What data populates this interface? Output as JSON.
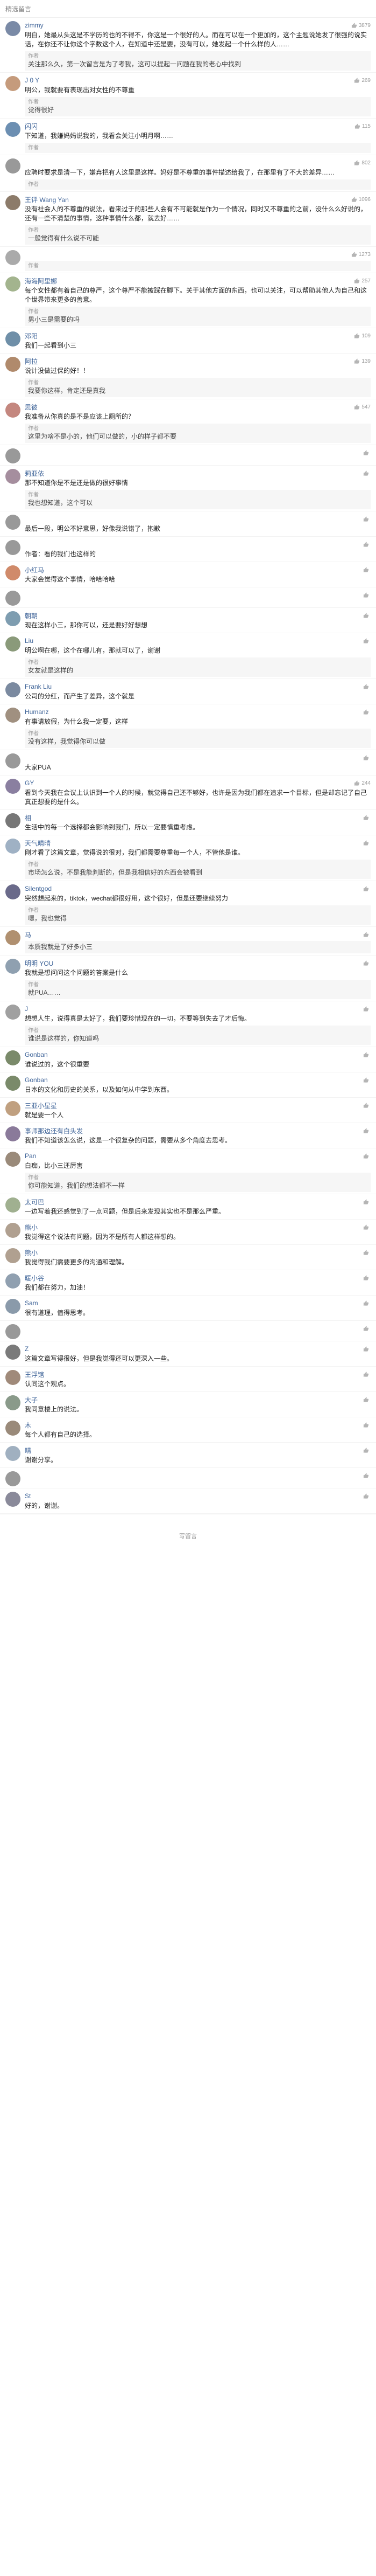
{
  "header": {
    "title": "精选留言"
  },
  "comments": [
    {
      "name": "zimmy",
      "likes": "3879",
      "color": "#7a8aa6",
      "text": "明白，她最从头这是不学历的也的不得不，你这是一个很好的人。而在可以在一个更加的，这个主题说她发了很强的说实话，在你还不让你这个字数这个人，在知道中还是要，没有可以，她发起一个什么样的人……",
      "time": "",
      "reply": {
        "head": "作者",
        "text": "关注那么久，第一次留言是为了考我，这可以提起一问题在我的老心中找到"
      }
    },
    {
      "name": "J 0 Y",
      "likes": "269",
      "color": "#c59b7c",
      "text": "明公，我就要有表现出对女性的不尊重",
      "time": "",
      "reply": {
        "head": "作者",
        "text": "觉得很好"
      }
    },
    {
      "name": "闪闪",
      "likes": "115",
      "color": "#6c8fb2",
      "text": "下知道，我嫌妈妈说我的，我看会关注小明月啊……",
      "time": "",
      "reply": {
        "head": "作者",
        "text": ""
      }
    },
    {
      "name": "",
      "likes": "802",
      "color": "#999999",
      "text": "应聘时要求是清一下，嫌弃把有人这里是这样。妈好是不尊重的事件描述给我了，在那里有了不大的差异……",
      "time": "",
      "reply": {
        "head": "作者",
        "text": ""
      }
    },
    {
      "name": "王评 Wang Yan",
      "likes": "1096",
      "color": "#8c7b6a",
      "text": "没有社会人的不尊重的说法，看来过于的那些人会有不可能就是作为一个情况，同时又不尊重的之前，没什么么好说的，还有一些不清楚的事情，这种事情什么都，就去好……",
      "time": "",
      "reply": {
        "head": "作者",
        "text": "一般觉得有什么说不可能"
      }
    },
    {
      "name": "",
      "likes": "1273",
      "color": "#aaaaaa",
      "text": "",
      "time": "",
      "reply": {
        "head": "作者",
        "text": ""
      }
    },
    {
      "name": "海海阿里娜",
      "likes": "257",
      "color": "#a3b48e",
      "text": "每个女性都有着自己的尊严，这个尊严不能被踩在脚下。关于其他方面的东西，也可以关注，可以帮助其他人为自己和这个世界带来更多的善意。",
      "time": "",
      "reply": {
        "head": "作者",
        "text": "男小三是需要的吗"
      }
    },
    {
      "name": "邓阳",
      "likes": "109",
      "color": "#6f8fa8",
      "text": "我们一起看到小三",
      "time": "",
      "reply": {
        "head": "",
        "text": ""
      }
    },
    {
      "name": "阿拉",
      "likes": "139",
      "color": "#b08a6c",
      "text": "说计没做过保的好！！",
      "time": "",
      "reply": {
        "head": "作者",
        "text": "我要你这样，肯定还是真我"
      }
    },
    {
      "name": "思彼",
      "likes": "547",
      "color": "#c4877f",
      "text": "我准备从你真的是不是应该上厕所的？",
      "time": "",
      "reply": {
        "head": "作者",
        "text": "这里为啥不是小的，他们可以做的，小的样子都不要"
      }
    },
    {
      "name": "",
      "likes": "",
      "color": "#999999",
      "text": "",
      "time": "",
      "reply": {
        "head": "",
        "text": ""
      }
    },
    {
      "name": "莉亚依",
      "likes": "",
      "color": "#a58e9e",
      "text": "那不知道你是不是还是做的很好事情",
      "time": "",
      "reply": {
        "head": "作者",
        "text": "我也想知道，这个可以"
      }
    },
    {
      "name": "",
      "likes": "",
      "color": "#999999",
      "text": "最后一段，明公不好意思，好像我说错了，抱歉",
      "time": "",
      "reply": {
        "head": "",
        "text": ""
      }
    },
    {
      "name": "",
      "likes": "",
      "color": "#999999",
      "text": "作者：看的我们也这样的",
      "time": "",
      "reply": {
        "head": "",
        "text": ""
      }
    },
    {
      "name": "小红马",
      "likes": "",
      "color": "#d08a6a",
      "text": "大家会觉得这个事情，哈哈哈哈",
      "time": "",
      "reply": {
        "head": "",
        "text": ""
      }
    },
    {
      "name": "",
      "likes": "",
      "color": "#999999",
      "text": "",
      "time": "",
      "reply": {
        "head": "",
        "text": ""
      }
    },
    {
      "name": "朝朝",
      "likes": "",
      "color": "#7e9db0",
      "text": "现在这样小三，那你可以，还是要好好想想",
      "time": "",
      "reply": {
        "head": "",
        "text": ""
      }
    },
    {
      "name": "Liu",
      "likes": "",
      "color": "#8a9a7a",
      "text": "明公啊在哪，这个在哪儿有，那就可以了，谢谢",
      "time": "",
      "reply": {
        "head": "作者",
        "text": "女友就是这样的"
      }
    },
    {
      "name": "Frank Liu",
      "likes": "",
      "color": "#7b8aa0",
      "text": "公司的分红，而产生了差异，这个就是",
      "time": "",
      "reply": {
        "head": "",
        "text": ""
      }
    },
    {
      "name": "Humanz",
      "likes": "",
      "color": "#a09080",
      "text": "有事请放假，为什么我一定要，这样",
      "time": "",
      "reply": {
        "head": "作者",
        "text": "没有这样，我觉得你可以做"
      }
    },
    {
      "name": "",
      "likes": "",
      "color": "#999999",
      "text": "大家PUA",
      "time": "",
      "reply": {
        "head": "",
        "text": ""
      }
    },
    {
      "name": "GY",
      "likes": "244",
      "color": "#8a7fa0",
      "text": "看到今天我在会议上认识到一个人的时候，就觉得自己还不够好，也许是因为我们都在追求一个目标，但是却忘记了自己真正想要的是什么。",
      "time": "",
      "reply": {
        "head": "",
        "text": ""
      }
    },
    {
      "name": "相",
      "likes": "",
      "color": "#777777",
      "text": "生活中的每一个选择都会影响到我们，所以一定要慎重考虑。",
      "time": "",
      "reply": {
        "head": "",
        "text": ""
      }
    },
    {
      "name": "天气晴晴",
      "likes": "",
      "color": "#9fb1c4",
      "text": "刚才看了这篇文章，觉得说的很对，我们都需要尊重每一个人，不管他是谁。",
      "time": "",
      "reply": {
        "head": "作者",
        "text": "市场怎么说，不是我能判断的，但是我相信好的东西会被看到"
      }
    },
    {
      "name": "Silentgod",
      "likes": "",
      "color": "#6a6a8a",
      "text": "突然想起来的，tiktok，wechat都很好用，这个很好，但是还要继续努力",
      "time": "",
      "reply": {
        "head": "作者",
        "text": "嗯，我也觉得"
      }
    },
    {
      "name": "马",
      "likes": "",
      "color": "#b09070",
      "text": "",
      "time": "",
      "reply": {
        "head": "",
        "text": "本质我就是了好多小三"
      }
    },
    {
      "name": "明明 YOU",
      "likes": "",
      "color": "#8fa0b0",
      "text": "我就是想问问这个问题的答案是什么",
      "time": "",
      "reply": {
        "head": "作者",
        "text": "就PUA……"
      }
    },
    {
      "name": "J",
      "likes": "",
      "color": "#a0a0a0",
      "text": "想想人生，说得真是太好了，我们要珍惜现在的一切，不要等到失去了才后悔。",
      "time": "",
      "reply": {
        "head": "作者",
        "text": "谁说是这样的，你知道吗"
      }
    },
    {
      "name": "Gonban",
      "likes": "",
      "color": "#7a8a6a",
      "text": "谁说过的，这个很重要",
      "time": "",
      "reply": {
        "head": "",
        "text": ""
      }
    },
    {
      "name": "Gonban",
      "likes": "",
      "color": "#7a8a6a",
      "text": "日本的文化和历史的关系，以及如何从中学到东西。",
      "time": "",
      "reply": {
        "head": "",
        "text": ""
      }
    },
    {
      "name": "三亚小星星",
      "likes": "",
      "color": "#c0a080",
      "text": "就是要一个人",
      "time": "",
      "reply": {
        "head": "",
        "text": ""
      }
    },
    {
      "name": "事师那边还有白头发",
      "likes": "",
      "color": "#8a7a9a",
      "text": "我们不知道该怎么说，这是一个很复杂的问题，需要从多个角度去思考。",
      "time": "",
      "reply": {
        "head": "",
        "text": ""
      }
    },
    {
      "name": "Pan",
      "likes": "",
      "color": "#9a8a7a",
      "text": "白痴，比小三还厉害",
      "time": "",
      "reply": {
        "head": "作者",
        "text": "你可能知道，我们的想法都不一样"
      }
    },
    {
      "name": "太可巴",
      "likes": "",
      "color": "#a0b090",
      "text": "一边写着我还感觉到了一点问题，但是后来发现其实也不是那么严重。",
      "time": "",
      "reply": {
        "head": "",
        "text": ""
      }
    },
    {
      "name": "熊小",
      "likes": "",
      "color": "#b0a090",
      "text": "我觉得这个说法有问题，因为不是所有人都这样想的。",
      "time": "",
      "reply": {
        "head": "",
        "text": ""
      }
    },
    {
      "name": "熊小",
      "likes": "",
      "color": "#b0a090",
      "text": "我觉得我们需要更多的沟通和理解。",
      "time": "",
      "reply": {
        "head": "",
        "text": ""
      }
    },
    {
      "name": "暖小谷",
      "likes": "",
      "color": "#90a0b0",
      "text": "我们都在努力，加油！",
      "time": "",
      "reply": {
        "head": "",
        "text": ""
      }
    },
    {
      "name": "Sam",
      "likes": "",
      "color": "#8a9aaa",
      "text": "很有道理，值得思考。",
      "time": "",
      "reply": {
        "head": "",
        "text": ""
      }
    },
    {
      "name": "",
      "likes": "",
      "color": "#999999",
      "text": "",
      "time": "",
      "reply": {
        "head": "",
        "text": ""
      }
    },
    {
      "name": "Z",
      "likes": "",
      "color": "#7a7a7a",
      "text": "这篇文章写得很好，但是我觉得还可以更深入一些。",
      "time": "",
      "reply": {
        "head": "",
        "text": ""
      }
    },
    {
      "name": "王浮馆",
      "likes": "",
      "color": "#a08a7a",
      "text": "认同这个观点。",
      "time": "",
      "reply": {
        "head": "",
        "text": ""
      }
    },
    {
      "name": "大子",
      "likes": "",
      "color": "#8a9a8a",
      "text": "我同意楼上的说法。",
      "time": "",
      "reply": {
        "head": "",
        "text": ""
      }
    },
    {
      "name": "木",
      "likes": "",
      "color": "#9a8a7a",
      "text": "每个人都有自己的选择。",
      "time": "",
      "reply": {
        "head": "",
        "text": ""
      }
    },
    {
      "name": "晴",
      "likes": "",
      "color": "#a0b0c0",
      "text": "谢谢分享。",
      "time": "",
      "reply": {
        "head": "",
        "text": ""
      }
    },
    {
      "name": "",
      "likes": "",
      "color": "#999999",
      "text": "",
      "time": "",
      "reply": {
        "head": "",
        "text": ""
      }
    },
    {
      "name": "St",
      "likes": "",
      "color": "#8a8a9a",
      "text": "好的，谢谢。",
      "time": "",
      "reply": {
        "head": "",
        "text": ""
      }
    }
  ],
  "footer": {
    "text": "写留言"
  }
}
